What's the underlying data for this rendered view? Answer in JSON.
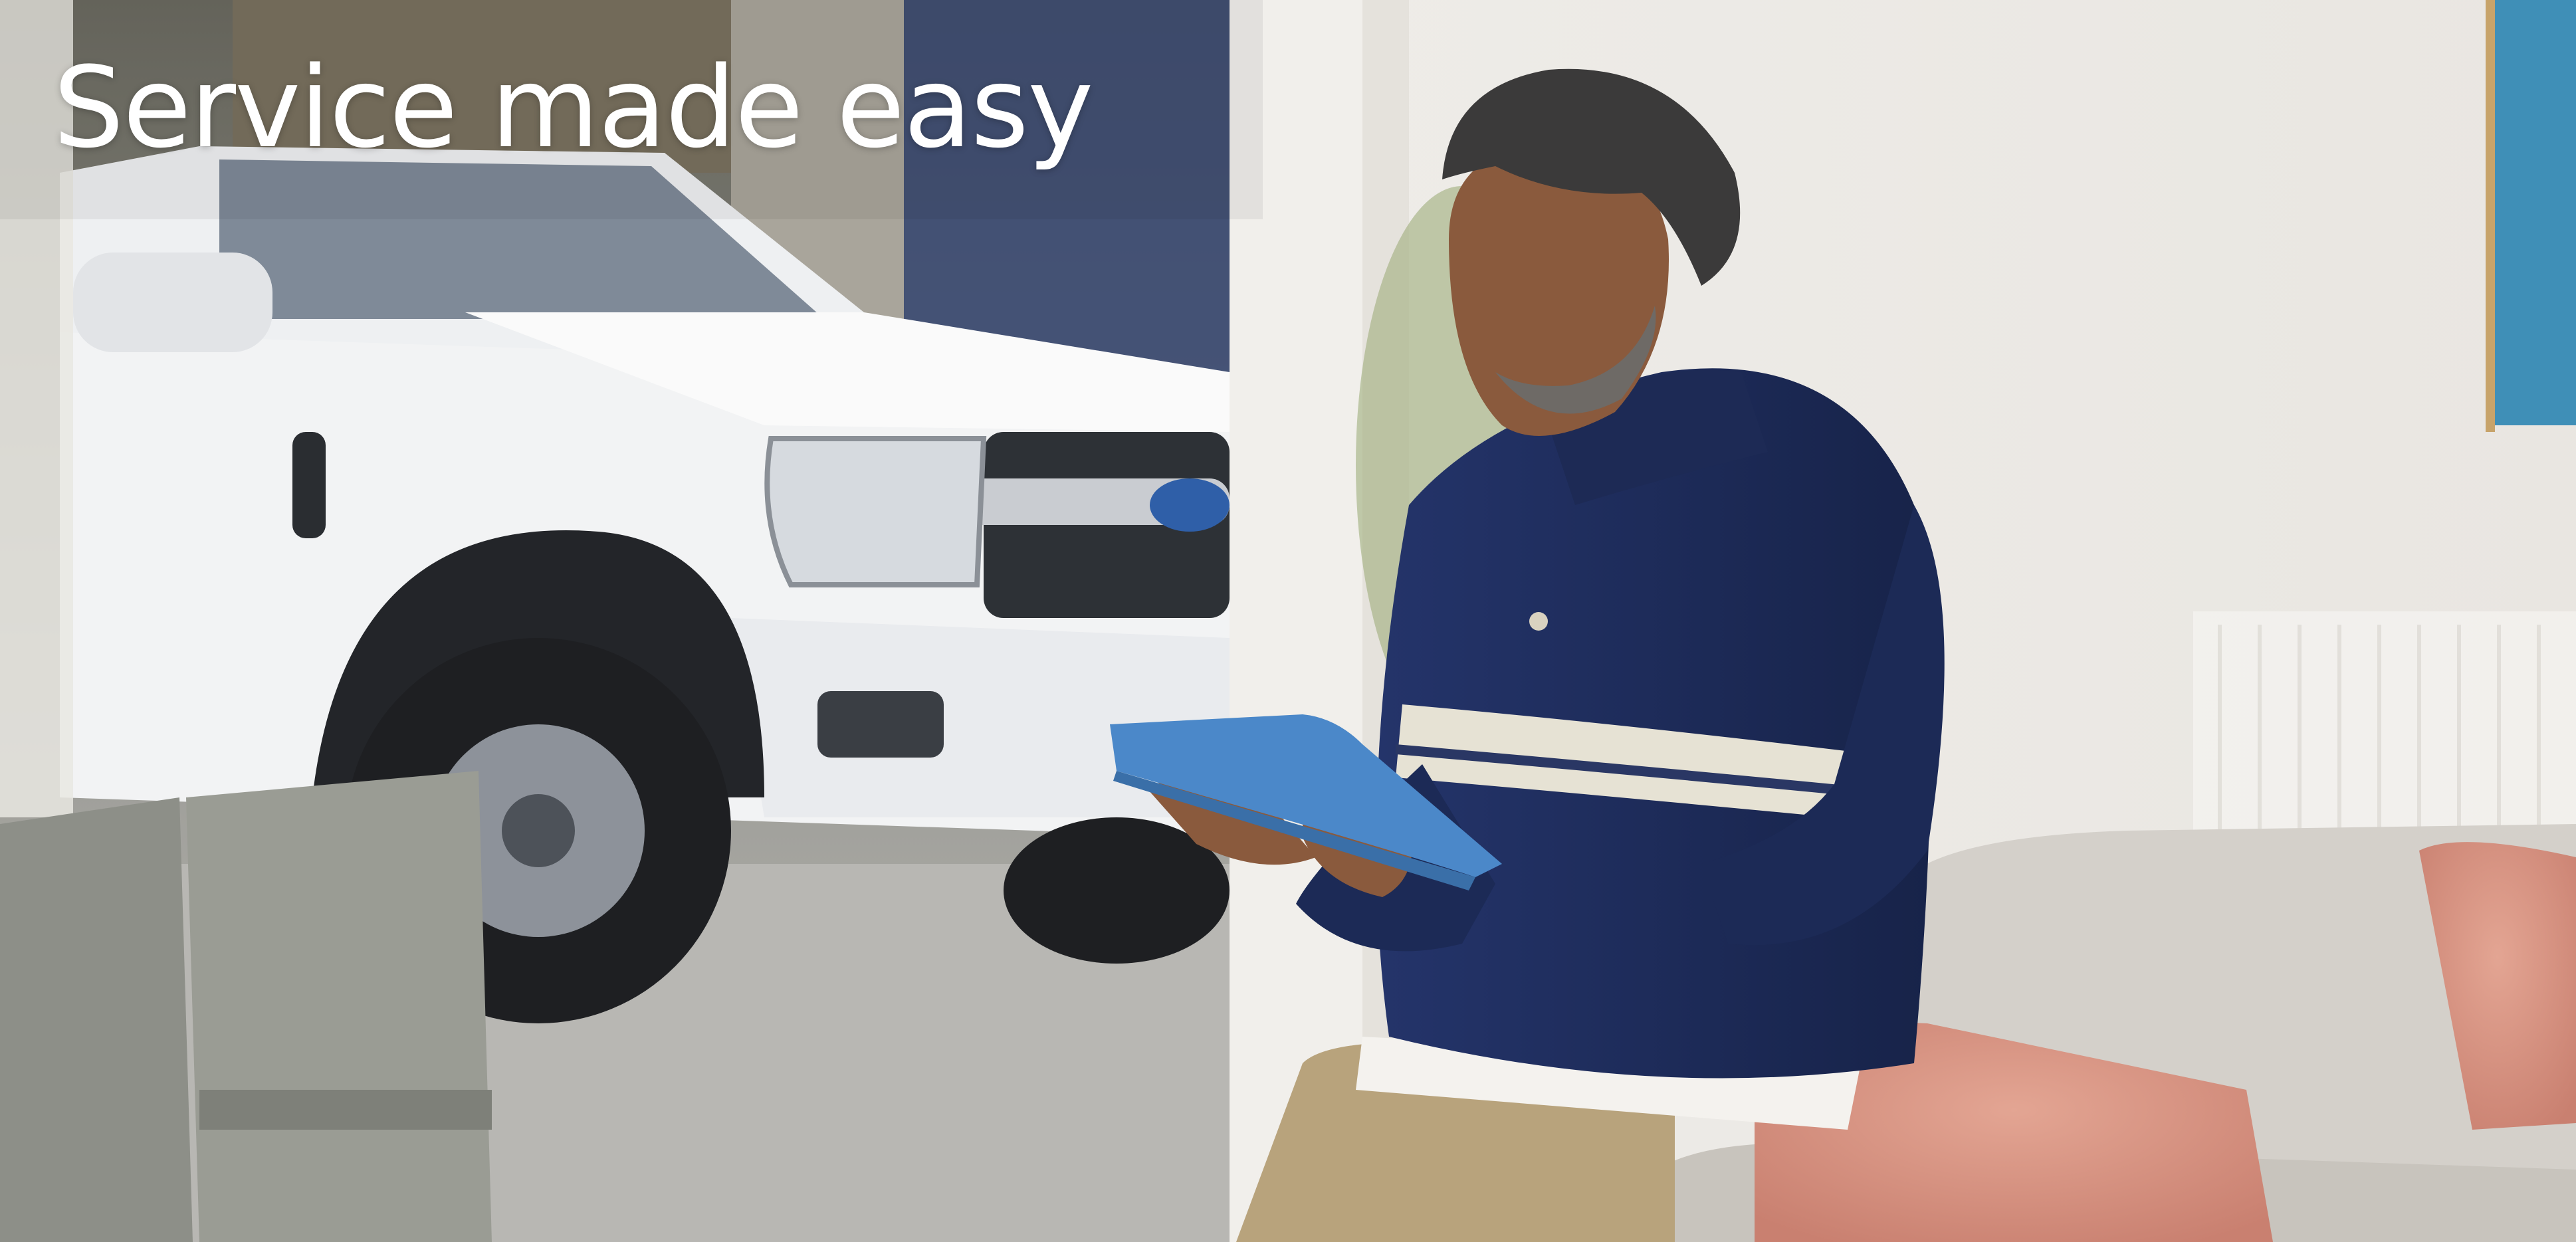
{
  "hero": {
    "headline": "Service made easy",
    "image_alt": "Man sitting on a sofa using a blue tablet, with a white pickup truck parked outside the window"
  },
  "colors": {
    "headline_text": "#ffffff",
    "truck_body": "#f2f3f4",
    "sweater_navy": "#1f2e5c",
    "sweater_stripe": "#e6e2d4",
    "tablet_blue": "#4b88c9",
    "cushion_pink": "#d99584",
    "sofa_grey": "#d4d0ca",
    "wall": "#efede9"
  },
  "icons": {
    "brand_emblem": "oval-badge-icon"
  }
}
